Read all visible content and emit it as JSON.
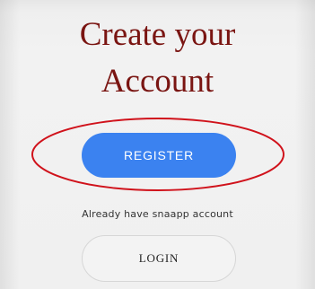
{
  "heading": {
    "line1": "Create your",
    "line2": "Account"
  },
  "register_button": {
    "label": "REGISTER"
  },
  "login_prompt": "Already have snaapp account",
  "login_button": {
    "label": "LOGIN"
  },
  "colors": {
    "heading": "#7a1512",
    "register_bg": "#3b82f0",
    "highlight": "#d0121b",
    "background": "#f0f0f0"
  }
}
